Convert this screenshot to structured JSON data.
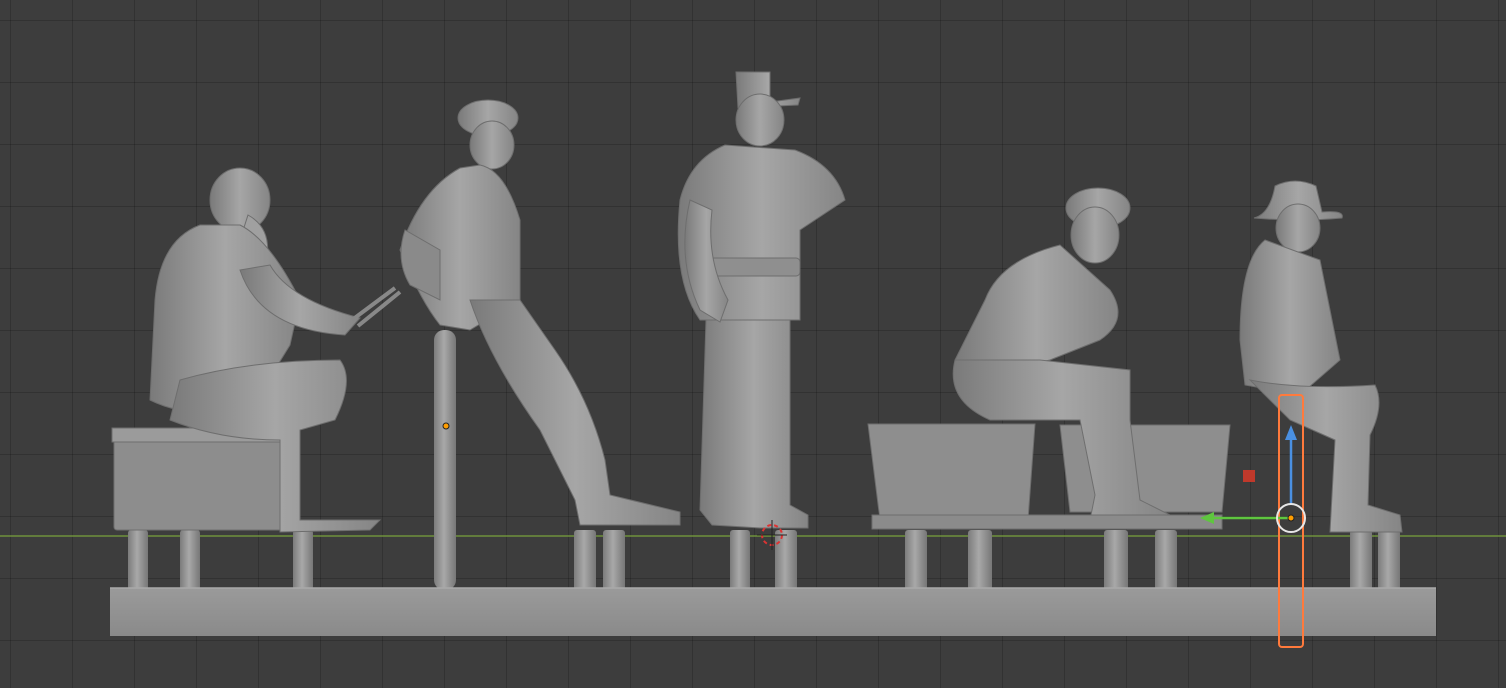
{
  "app": {
    "view": "3d-viewport",
    "theme": {
      "background": "#3d3d3d",
      "grid_line": "#333333",
      "x_axis": "#7aa33c",
      "model": "#9a9a9a",
      "model_shadow": "#6a6a6a",
      "selection": "#ff7a3c",
      "gizmo_y": "#5fc63f",
      "gizmo_z": "#4a90e2",
      "origin": "#ff9d00",
      "light": "#c0392b"
    }
  },
  "scene": {
    "objects": [
      {
        "name": "base-plate",
        "type": "mesh"
      },
      {
        "name": "figure-seated-bearded-man",
        "type": "mesh"
      },
      {
        "name": "storage-trunk",
        "type": "mesh"
      },
      {
        "name": "figure-leaning-soldier",
        "type": "mesh"
      },
      {
        "name": "figure-standing-soldier",
        "type": "mesh"
      },
      {
        "name": "figure-soldier-with-tubs",
        "type": "mesh"
      },
      {
        "name": "wash-tub-left",
        "type": "mesh"
      },
      {
        "name": "wash-tub-right",
        "type": "mesh"
      },
      {
        "name": "figure-seated-man-hat",
        "type": "mesh"
      },
      {
        "name": "support-pillar-selected",
        "type": "mesh",
        "selected": true
      }
    ],
    "gizmo": {
      "axes": [
        "y",
        "z"
      ],
      "y_color": "#5fc63f",
      "z_color": "#4a90e2"
    },
    "cursor_3d": "3d-cursor-icon"
  }
}
